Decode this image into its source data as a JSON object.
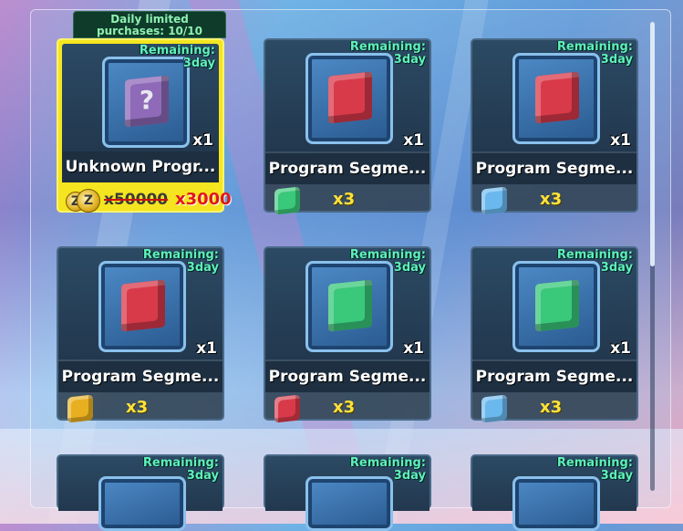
{
  "colors": {
    "remaining_text": "#5ff2b8",
    "price_qty": "#ffe23a",
    "discount_price": "#e01818",
    "highlight_card": "#f5e520"
  },
  "daily_tag": {
    "line1": "Daily limited",
    "line2": "purchases: 10/10"
  },
  "items": [
    {
      "remaining_label": "Remaining:",
      "remaining_value": "3day",
      "name": "Unknown Progr...",
      "qty": "x1",
      "cube_color": "#8e6ab8",
      "cube_icon": "question-mark",
      "price_old": "x50000",
      "price_new": "x3000",
      "currency_icon": "z-coin-icon"
    },
    {
      "remaining_label": "Remaining:",
      "remaining_value": "3day",
      "name": "Program Segme...",
      "qty": "x1",
      "cube_color": "#d83a4a",
      "price_qty": "x3",
      "currency_color": "#3ac87a"
    },
    {
      "remaining_label": "Remaining:",
      "remaining_value": "3day",
      "name": "Program Segme...",
      "qty": "x1",
      "cube_color": "#d83a4a",
      "price_qty": "x3",
      "currency_color": "#6ab8ee"
    },
    {
      "remaining_label": "Remaining:",
      "remaining_value": "3day",
      "name": "Program Segme...",
      "qty": "x1",
      "cube_color": "#d83a4a",
      "price_qty": "x3",
      "currency_color": "#e8b020"
    },
    {
      "remaining_label": "Remaining:",
      "remaining_value": "3day",
      "name": "Program Segme...",
      "qty": "x1",
      "cube_color": "#3ac87a",
      "price_qty": "x3",
      "currency_color": "#d83a4a"
    },
    {
      "remaining_label": "Remaining:",
      "remaining_value": "3day",
      "name": "Program Segme...",
      "qty": "x1",
      "cube_color": "#3ac87a",
      "price_qty": "x3",
      "currency_color": "#6ab8ee"
    },
    {
      "remaining_label": "Remaining:",
      "remaining_value": "3day"
    },
    {
      "remaining_label": "Remaining:",
      "remaining_value": "3day"
    },
    {
      "remaining_label": "Remaining:",
      "remaining_value": "3day"
    }
  ]
}
